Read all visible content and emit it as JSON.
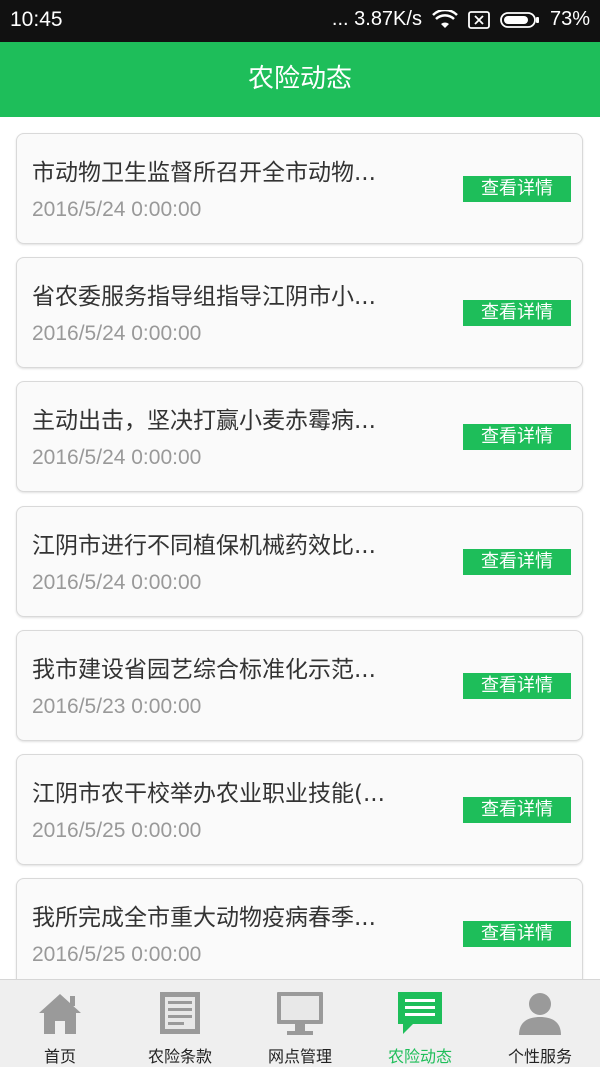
{
  "status_bar": {
    "time": "10:45",
    "network_speed": "... 3.87K/s",
    "battery": "73%"
  },
  "header": {
    "title": "农险动态"
  },
  "news": [
    {
      "title": "市动物卫生监督所召开全市动物...",
      "date": "2016/5/24 0:00:00",
      "button": "查看详情"
    },
    {
      "title": "省农委服务指导组指导江阴市小...",
      "date": "2016/5/24 0:00:00",
      "button": "查看详情"
    },
    {
      "title": "主动出击，坚决打赢小麦赤霉病...",
      "date": "2016/5/24 0:00:00",
      "button": "查看详情"
    },
    {
      "title": "江阴市进行不同植保机械药效比...",
      "date": "2016/5/24 0:00:00",
      "button": "查看详情"
    },
    {
      "title": "我市建设省园艺综合标准化示范...",
      "date": "2016/5/23 0:00:00",
      "button": "查看详情"
    },
    {
      "title": "江阴市农干校举办农业职业技能(...",
      "date": "2016/5/25 0:00:00",
      "button": "查看详情"
    },
    {
      "title": "我所完成全市重大动物疫病春季...",
      "date": "2016/5/25 0:00:00",
      "button": "查看详情"
    }
  ],
  "tabs": [
    {
      "label": "首页",
      "icon": "home-icon"
    },
    {
      "label": "农险条款",
      "icon": "document-icon"
    },
    {
      "label": "网点管理",
      "icon": "monitor-icon"
    },
    {
      "label": "农险动态",
      "icon": "message-icon"
    },
    {
      "label": "个性服务",
      "icon": "user-icon"
    }
  ],
  "colors": {
    "brand_green": "#1ebe5a",
    "inactive_icon": "#9a9a9a"
  }
}
